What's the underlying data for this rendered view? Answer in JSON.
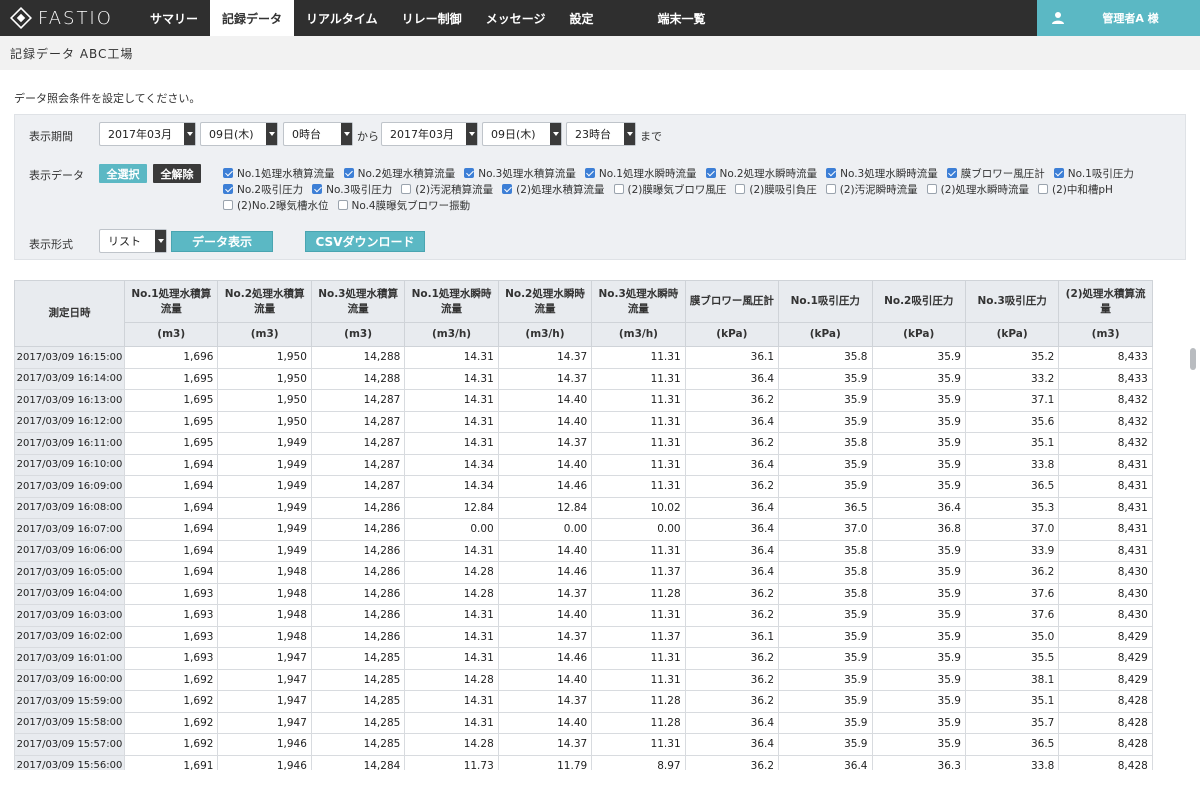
{
  "brand": {
    "name": "FASTIO"
  },
  "nav": [
    {
      "label": "サマリー",
      "active": false
    },
    {
      "label": "記録データ",
      "active": true
    },
    {
      "label": "リアルタイム",
      "active": false
    },
    {
      "label": "リレー制御",
      "active": false
    },
    {
      "label": "メッセージ",
      "active": false
    },
    {
      "label": "設定",
      "active": false
    }
  ],
  "nav_device": "端末一覧",
  "user": {
    "name": "管理者A 様",
    "icon": "user-icon"
  },
  "page_title": "記録データ ABC工場",
  "instruction": "データ照会条件を設定してください。",
  "period": {
    "label": "表示期間",
    "from_month": "2017年03月",
    "from_day": "09日(木)",
    "from_hour": "0時台",
    "from_text": "から",
    "to_month": "2017年03月",
    "to_day": "09日(木)",
    "to_hour": "23時台",
    "to_text": "まで"
  },
  "display_data": {
    "label": "表示データ",
    "select_all": "全選択",
    "clear_all": "全解除",
    "rows": [
      [
        {
          "label": "No.1処理水積算流量",
          "checked": true
        },
        {
          "label": "No.2処理水積算流量",
          "checked": true
        },
        {
          "label": "No.3処理水積算流量",
          "checked": true
        },
        {
          "label": "No.1処理水瞬時流量",
          "checked": true
        },
        {
          "label": "No.2処理水瞬時流量",
          "checked": true
        },
        {
          "label": "No.3処理水瞬時流量",
          "checked": true
        },
        {
          "label": "膜ブロワー風圧計",
          "checked": true
        },
        {
          "label": "No.1吸引圧力",
          "checked": true
        }
      ],
      [
        {
          "label": "No.2吸引圧力",
          "checked": true
        },
        {
          "label": "No.3吸引圧力",
          "checked": true
        },
        {
          "label": "(2)汚泥積算流量",
          "checked": false
        },
        {
          "label": "(2)処理水積算流量",
          "checked": true
        },
        {
          "label": "(2)膜曝気ブロワ風圧",
          "checked": false
        },
        {
          "label": "(2)膜吸引負圧",
          "checked": false
        },
        {
          "label": "(2)汚泥瞬時流量",
          "checked": false
        },
        {
          "label": "(2)処理水瞬時流量",
          "checked": false
        },
        {
          "label": "(2)中和槽pH",
          "checked": false
        }
      ],
      [
        {
          "label": "(2)No.2曝気槽水位",
          "checked": false
        },
        {
          "label": "No.4膜曝気ブロワー振動",
          "checked": false
        }
      ]
    ]
  },
  "format": {
    "label": "表示形式",
    "value": "リスト",
    "show_button": "データ表示",
    "csv_button": "CSVダウンロード"
  },
  "table": {
    "date_header": "測定日時",
    "columns": [
      {
        "name": "No.1処理水積算流量",
        "unit": "(m3)"
      },
      {
        "name": "No.2処理水積算流量",
        "unit": "(m3)"
      },
      {
        "name": "No.3処理水積算流量",
        "unit": "(m3)"
      },
      {
        "name": "No.1処理水瞬時流量",
        "unit": "(m3/h)"
      },
      {
        "name": "No.2処理水瞬時流量",
        "unit": "(m3/h)"
      },
      {
        "name": "No.3処理水瞬時流量",
        "unit": "(m3/h)"
      },
      {
        "name": "膜ブロワー風圧計",
        "unit": "(kPa)"
      },
      {
        "name": "No.1吸引圧力",
        "unit": "(kPa)"
      },
      {
        "name": "No.2吸引圧力",
        "unit": "(kPa)"
      },
      {
        "name": "No.3吸引圧力",
        "unit": "(kPa)"
      },
      {
        "name": "(2)処理水積算流量",
        "unit": "(m3)"
      }
    ],
    "rows": [
      [
        "2017/03/09 16:15:00",
        "1,696",
        "1,950",
        "14,288",
        "14.31",
        "14.37",
        "11.31",
        "36.1",
        "35.8",
        "35.9",
        "35.2",
        "8,433"
      ],
      [
        "2017/03/09 16:14:00",
        "1,695",
        "1,950",
        "14,288",
        "14.31",
        "14.37",
        "11.31",
        "36.4",
        "35.9",
        "35.9",
        "33.2",
        "8,433"
      ],
      [
        "2017/03/09 16:13:00",
        "1,695",
        "1,950",
        "14,287",
        "14.31",
        "14.40",
        "11.31",
        "36.2",
        "35.9",
        "35.9",
        "37.1",
        "8,432"
      ],
      [
        "2017/03/09 16:12:00",
        "1,695",
        "1,950",
        "14,287",
        "14.31",
        "14.40",
        "11.31",
        "36.4",
        "35.9",
        "35.9",
        "35.6",
        "8,432"
      ],
      [
        "2017/03/09 16:11:00",
        "1,695",
        "1,949",
        "14,287",
        "14.31",
        "14.37",
        "11.31",
        "36.2",
        "35.8",
        "35.9",
        "35.1",
        "8,432"
      ],
      [
        "2017/03/09 16:10:00",
        "1,694",
        "1,949",
        "14,287",
        "14.34",
        "14.40",
        "11.31",
        "36.4",
        "35.9",
        "35.9",
        "33.8",
        "8,431"
      ],
      [
        "2017/03/09 16:09:00",
        "1,694",
        "1,949",
        "14,287",
        "14.34",
        "14.46",
        "11.31",
        "36.2",
        "35.9",
        "35.9",
        "36.5",
        "8,431"
      ],
      [
        "2017/03/09 16:08:00",
        "1,694",
        "1,949",
        "14,286",
        "12.84",
        "12.84",
        "10.02",
        "36.4",
        "36.5",
        "36.4",
        "35.3",
        "8,431"
      ],
      [
        "2017/03/09 16:07:00",
        "1,694",
        "1,949",
        "14,286",
        "0.00",
        "0.00",
        "0.00",
        "36.4",
        "37.0",
        "36.8",
        "37.0",
        "8,431"
      ],
      [
        "2017/03/09 16:06:00",
        "1,694",
        "1,949",
        "14,286",
        "14.31",
        "14.40",
        "11.31",
        "36.4",
        "35.8",
        "35.9",
        "33.9",
        "8,431"
      ],
      [
        "2017/03/09 16:05:00",
        "1,694",
        "1,948",
        "14,286",
        "14.28",
        "14.46",
        "11.37",
        "36.4",
        "35.8",
        "35.9",
        "36.2",
        "8,430"
      ],
      [
        "2017/03/09 16:04:00",
        "1,693",
        "1,948",
        "14,286",
        "14.28",
        "14.37",
        "11.28",
        "36.2",
        "35.8",
        "35.9",
        "37.6",
        "8,430"
      ],
      [
        "2017/03/09 16:03:00",
        "1,693",
        "1,948",
        "14,286",
        "14.31",
        "14.40",
        "11.31",
        "36.2",
        "35.9",
        "35.9",
        "37.6",
        "8,430"
      ],
      [
        "2017/03/09 16:02:00",
        "1,693",
        "1,948",
        "14,286",
        "14.31",
        "14.37",
        "11.37",
        "36.1",
        "35.9",
        "35.9",
        "35.0",
        "8,429"
      ],
      [
        "2017/03/09 16:01:00",
        "1,693",
        "1,947",
        "14,285",
        "14.31",
        "14.46",
        "11.31",
        "36.2",
        "35.9",
        "35.9",
        "35.5",
        "8,429"
      ],
      [
        "2017/03/09 16:00:00",
        "1,692",
        "1,947",
        "14,285",
        "14.28",
        "14.40",
        "11.31",
        "36.2",
        "35.9",
        "35.9",
        "38.1",
        "8,429"
      ],
      [
        "2017/03/09 15:59:00",
        "1,692",
        "1,947",
        "14,285",
        "14.31",
        "14.37",
        "11.28",
        "36.2",
        "35.9",
        "35.9",
        "35.1",
        "8,428"
      ],
      [
        "2017/03/09 15:58:00",
        "1,692",
        "1,947",
        "14,285",
        "14.31",
        "14.40",
        "11.28",
        "36.4",
        "35.9",
        "35.9",
        "35.7",
        "8,428"
      ],
      [
        "2017/03/09 15:57:00",
        "1,692",
        "1,946",
        "14,285",
        "14.28",
        "14.37",
        "11.31",
        "36.4",
        "35.9",
        "35.9",
        "36.5",
        "8,428"
      ],
      [
        "2017/03/09 15:56:00",
        "1,691",
        "1,946",
        "14,284",
        "11.73",
        "11.79",
        "8.97",
        "36.2",
        "36.4",
        "36.3",
        "33.8",
        "8,428"
      ]
    ]
  },
  "colors": {
    "topbar": "#2f2f2f",
    "accent": "#5bb8c4",
    "checkbox": "#3d7fd6"
  }
}
